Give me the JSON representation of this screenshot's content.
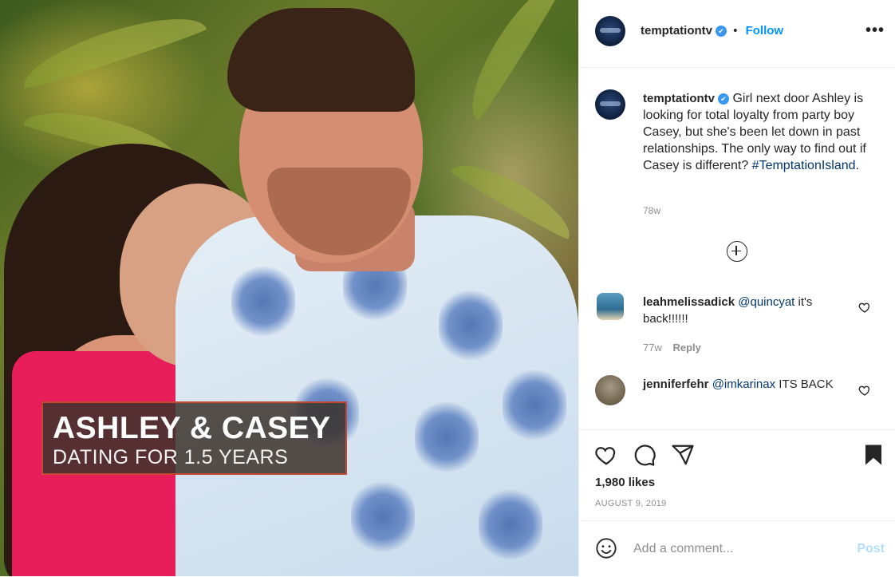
{
  "post": {
    "caption_overlay": {
      "title": "ASHLEY & CASEY",
      "subtitle": "DATING FOR 1.5 YEARS"
    }
  },
  "header": {
    "username": "temptationtv",
    "separator": "•",
    "follow_label": "Follow",
    "more_icon": "more-horizontal-icon"
  },
  "caption": {
    "username": "temptationtv",
    "text": "Girl next door Ashley is looking for total loyalty from party boy Casey, but she's been let down in past relationships. The only way to find out if Casey is different?",
    "hashtag": "#TemptationIsland",
    "suffix": ".",
    "time": "78w"
  },
  "comments": [
    {
      "username": "leahmelissadick",
      "mention": "@quincyat",
      "text": "it's back!!!!!!",
      "time": "77w",
      "reply_label": "Reply"
    },
    {
      "username": "jenniferfehr",
      "mention": "@imkarinax",
      "text": "ITS BACK"
    }
  ],
  "actions": {
    "likes": "1,980 likes",
    "date": "AUGUST 9, 2019",
    "icons": [
      "heart-icon",
      "comment-icon",
      "share-icon",
      "bookmark-icon"
    ]
  },
  "add_comment": {
    "placeholder": "Add a comment...",
    "post_label": "Post"
  },
  "colors": {
    "accent": "#0095f6",
    "verified": "#3897f0",
    "post_disabled": "#b2dffc",
    "overlay_border": "#c0492f"
  }
}
